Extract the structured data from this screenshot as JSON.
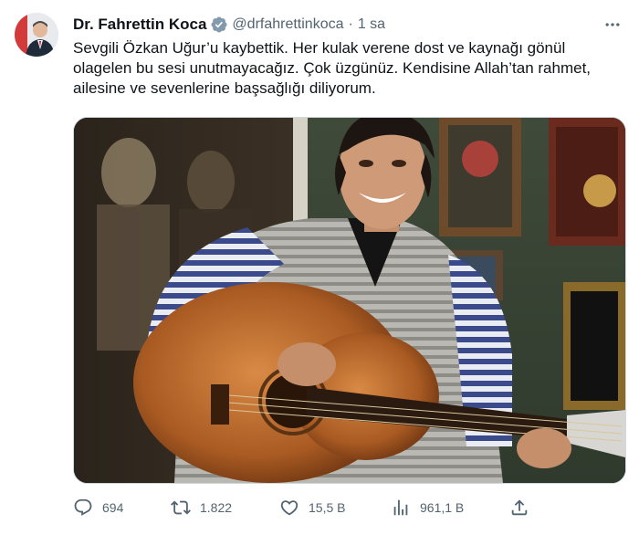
{
  "author": {
    "name": "Dr. Fahrettin Koca",
    "handle": "@drfahrettinkoca",
    "separator": "·",
    "time": "1 sa"
  },
  "tweet": {
    "lines": [
      "Sevgili Özkan Uğur’u kaybettik. Her kulak verene dost ve kaynağı gönül",
      "olagelen bu sesi unutmayacağız. Çok üzgünüz. Kendisine Allah’tan rahmet,",
      "ailesine ve sevenlerine başsağlığı diliyorum."
    ]
  },
  "actions": {
    "replies": "694",
    "retweets": "1.822",
    "likes": "15,5 B",
    "views": "961,1 B"
  },
  "icons": {
    "verified": "verified-badge-icon",
    "more": "more-horizontal-icon",
    "reply": "reply-icon",
    "retweet": "retweet-icon",
    "like": "heart-icon",
    "views": "views-chart-icon",
    "share": "share-icon"
  },
  "colors": {
    "verified_badge": "#829aab",
    "secondary_text": "#536471",
    "primary_text": "#0f1419",
    "border": "#cfd9de"
  }
}
